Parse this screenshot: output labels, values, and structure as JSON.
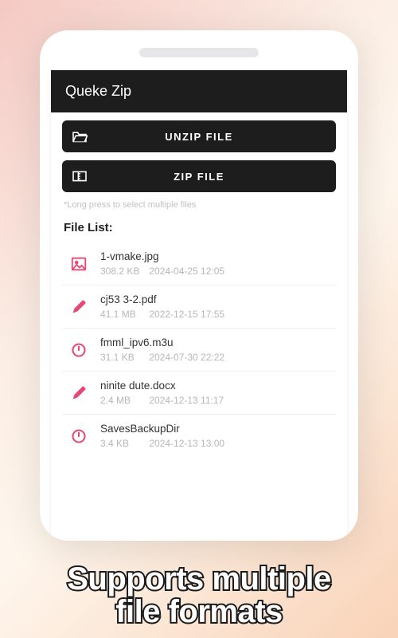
{
  "app": {
    "title": "Queke Zip"
  },
  "actions": {
    "unzip_label": "UNZIP FILE",
    "zip_label": "ZIP FILE"
  },
  "hint": "*Long press to select multiple files",
  "list_title": "File List:",
  "files": [
    {
      "name": "1-vmake.jpg",
      "size": "308.2 KB",
      "ts": "2024-04-25 12:05",
      "icon": "image"
    },
    {
      "name": "cj53 3-2.pdf",
      "size": "41.1 MB",
      "ts": "2022-12-15 17:55",
      "icon": "pencil"
    },
    {
      "name": "fmml_ipv6.m3u",
      "size": "31.1 KB",
      "ts": "2024-07-30 22:22",
      "icon": "power"
    },
    {
      "name": "ninite dute.docx",
      "size": "2.4 MB",
      "ts": "2024-12-13 11:17",
      "icon": "pencil"
    },
    {
      "name": "SavesBackupDir",
      "size": "3.4 KB",
      "ts": "2024-12-13 13:00",
      "icon": "power"
    }
  ],
  "caption_line1": "Supports multiple",
  "caption_line2": "file formats",
  "colors": {
    "accent": "#e84974",
    "dark": "#1d1d1d"
  }
}
